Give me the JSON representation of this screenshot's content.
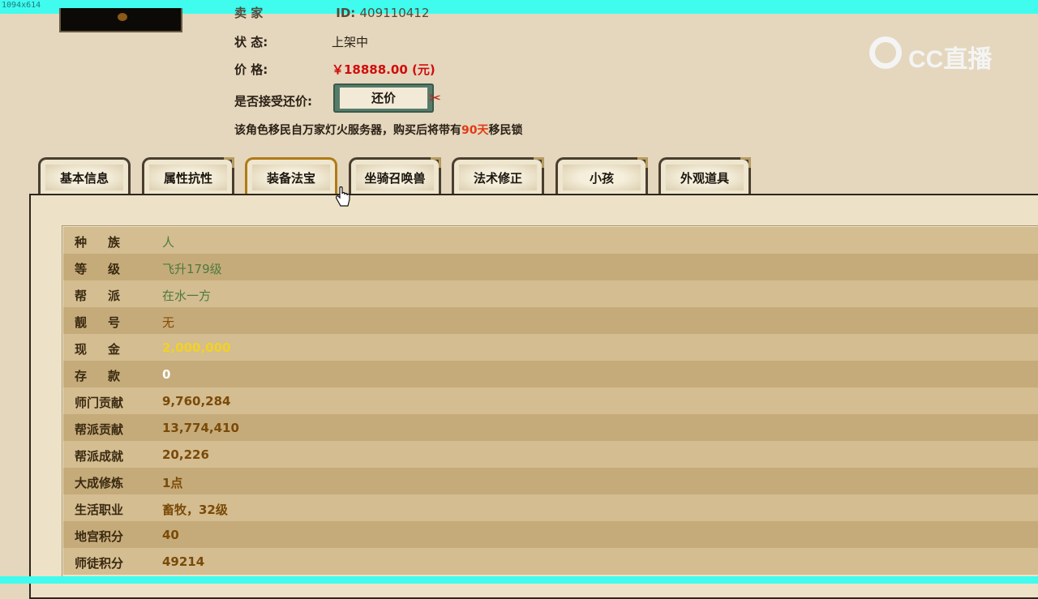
{
  "window": {
    "dims_label": "1094x614"
  },
  "seller": {
    "label": "卖 家",
    "id_label": "ID:",
    "id_value": "409110412"
  },
  "status": {
    "label": "状 态:",
    "value": "上架中"
  },
  "price": {
    "label": "价 格:",
    "value": "￥18888.00 (元)"
  },
  "bargain": {
    "label": "是否接受还价:",
    "button": "还价"
  },
  "note": {
    "prefix": "该角色移民自万家灯火服务器，购买后将带有",
    "highlight": "90天",
    "suffix": "移民锁"
  },
  "logo": {
    "text": "CC直播"
  },
  "tabs": [
    {
      "label": "基本信息"
    },
    {
      "label": "属性抗性"
    },
    {
      "label": "装备法宝"
    },
    {
      "label": "坐骑召唤兽"
    },
    {
      "label": "法术修正"
    },
    {
      "label": "小孩"
    },
    {
      "label": "外观道具"
    }
  ],
  "attributes": [
    {
      "key": "种族",
      "value": "人"
    },
    {
      "key": "等级",
      "value": "飞升179级"
    },
    {
      "key": "帮派",
      "value": "在水一方"
    },
    {
      "key": "靓号",
      "value": "无"
    },
    {
      "key": "现金",
      "value": "2,000,000"
    },
    {
      "key": "存款",
      "value": "0"
    },
    {
      "key": "师门贡献",
      "value": "9,760,284"
    },
    {
      "key": "帮派贡献",
      "value": "13,774,410"
    },
    {
      "key": "帮派成就",
      "value": "20,226"
    },
    {
      "key": "大成修炼",
      "value": "1点"
    },
    {
      "key": "生活职业",
      "value": "畜牧，32级"
    },
    {
      "key": "地宫积分",
      "value": "40"
    },
    {
      "key": "师徒积分",
      "value": "49214"
    }
  ]
}
